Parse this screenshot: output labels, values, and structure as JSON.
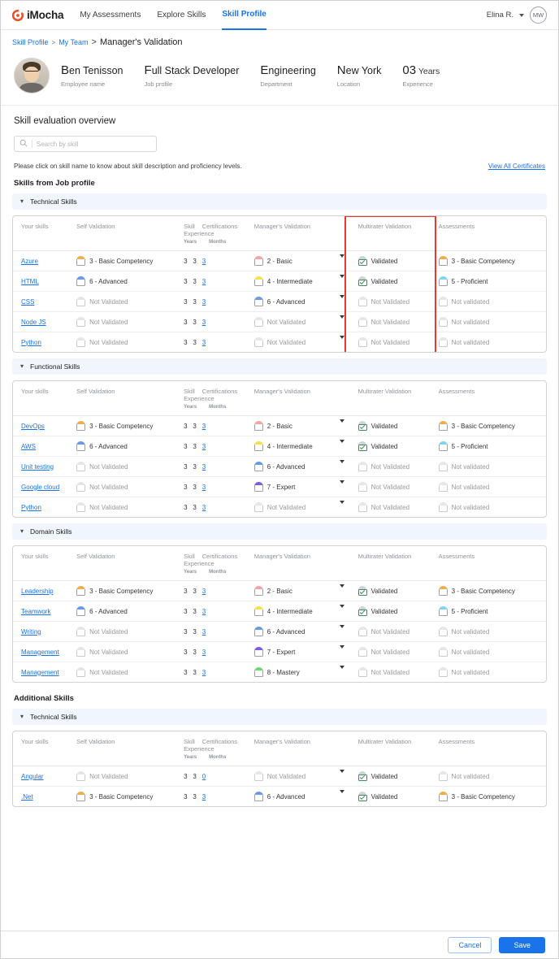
{
  "topnav": {
    "brand": "iMocha",
    "items": [
      {
        "label": "My Assessments",
        "active": false
      },
      {
        "label": "Explore Skills",
        "active": false
      },
      {
        "label": "Skill Profile",
        "active": true
      }
    ],
    "user_name": "Elina R.",
    "avatar_initials": "MW"
  },
  "breadcrumb": {
    "l1": "Skill Profile",
    "sep1": ">",
    "l2": "My Team",
    "sep2": ">",
    "current": "Manager's Validation"
  },
  "profile": {
    "fields": [
      {
        "value": "Ben Tenisson",
        "cap": "B",
        "rest": "en Tenisson",
        "label": "Employee name"
      },
      {
        "value": "Full Stack Developer",
        "cap": "F",
        "rest": "ull Stack Developer",
        "label": "Job profile"
      },
      {
        "value": "Engineering",
        "cap": "E",
        "rest": "ngineering",
        "label": "Department"
      },
      {
        "value": "New York",
        "cap": "N",
        "rest": "ew York",
        "label": "Location"
      },
      {
        "value": "03 Years",
        "cap": "03",
        "rest": " Years",
        "label": "Experience"
      }
    ]
  },
  "overview": {
    "title": "Skill evaluation overview",
    "search_placeholder": "Search by skill",
    "search_value": "",
    "hint": "Please click on skill name to know about skill description and proficiency levels.",
    "certificates_link": "View All Certificates",
    "group_job_profile": "Skills from Job profile",
    "group_additional": "Additional Skills"
  },
  "columns": {
    "skill": "Your skills",
    "self": "Self Validation",
    "experience": "Skill Experience",
    "years": "Years",
    "months": "Months",
    "certifications": "Certifications",
    "manager": "Manager's Validation",
    "multirater": "Multirater Validation",
    "assessments": "Assessments"
  },
  "sections": [
    {
      "accordion_label": "Technical Skills",
      "highlight_multirater": true,
      "rows": [
        {
          "skill": "Azure",
          "self": "3 - Basic Competency",
          "self_color": "#f0ad4e",
          "years": "3",
          "months": "3",
          "certs": "3",
          "mgr": "2 - Basic",
          "mgr_color": "#f5a3a3",
          "multi": "Validated",
          "multi_state": "validated",
          "assess": "3 - Basic Competency",
          "assess_color": "#f0ad4e"
        },
        {
          "skill": "HTML",
          "self": "6 - Advanced",
          "self_color": "#6b9ae8",
          "years": "3",
          "months": "3",
          "certs": "3",
          "mgr": "4 - Intermediate",
          "mgr_color": "#f5e04d",
          "multi": "Validated",
          "multi_state": "validated",
          "assess": "5 - Proficient",
          "assess_color": "#7fd4f0"
        },
        {
          "skill": "CSS",
          "self": "Not Validated",
          "self_color": "",
          "years": "3",
          "months": "3",
          "certs": "3",
          "mgr": "6 - Advanced",
          "mgr_color": "#6b9ae8",
          "multi": "Not Validated",
          "multi_state": "none",
          "assess": "Not  validated",
          "assess_color": ""
        },
        {
          "skill": "Node JS",
          "self": "Not Validated",
          "self_color": "",
          "years": "3",
          "months": "3",
          "certs": "3",
          "mgr": "Not Validated",
          "mgr_color": "",
          "multi": "Not Validated",
          "multi_state": "none",
          "assess": "Not  validated",
          "assess_color": ""
        },
        {
          "skill": "Python",
          "self": "Not Validated",
          "self_color": "",
          "years": "3",
          "months": "3",
          "certs": "3",
          "mgr": "Not Validated",
          "mgr_color": "",
          "multi": "Not Validated",
          "multi_state": "none",
          "assess": "Not  validated",
          "assess_color": ""
        }
      ]
    },
    {
      "accordion_label": "Functional Skills",
      "highlight_multirater": false,
      "rows": [
        {
          "skill": "DevOps",
          "self": "3 - Basic Competency",
          "self_color": "#f0ad4e",
          "years": "3",
          "months": "3",
          "certs": "3",
          "mgr": "2 - Basic",
          "mgr_color": "#f5a3a3",
          "multi": "Validated",
          "multi_state": "validated",
          "assess": "3 - Basic Competency",
          "assess_color": "#f0ad4e"
        },
        {
          "skill": "AWS",
          "self": "6 - Advanced",
          "self_color": "#6b9ae8",
          "years": "3",
          "months": "3",
          "certs": "3",
          "mgr": "4 - Intermediate",
          "mgr_color": "#f5e04d",
          "multi": "Validated",
          "multi_state": "validated",
          "assess": "5 - Proficient",
          "assess_color": "#7fd4f0"
        },
        {
          "skill": "Unit testing",
          "self": "Not Validated",
          "self_color": "",
          "years": "3",
          "months": "3",
          "certs": "3",
          "mgr": "6 - Advanced",
          "mgr_color": "#6b9ae8",
          "multi": "Not Validated",
          "multi_state": "none",
          "assess": "Not  validated",
          "assess_color": ""
        },
        {
          "skill": "Google cloud",
          "self": "Not Validated",
          "self_color": "",
          "years": "3",
          "months": "3",
          "certs": "3",
          "mgr": "7 - Expert",
          "mgr_color": "#7b5ce8",
          "multi": "Not Validated",
          "multi_state": "none",
          "assess": "Not  validated",
          "assess_color": ""
        },
        {
          "skill": "Python",
          "self": "Not Validated",
          "self_color": "",
          "years": "3",
          "months": "3",
          "certs": "3",
          "mgr": "Not Validated",
          "mgr_color": "",
          "multi": "Not Validated",
          "multi_state": "none",
          "assess": "Not  validated",
          "assess_color": ""
        }
      ]
    },
    {
      "accordion_label": "Domain Skills",
      "highlight_multirater": false,
      "rows": [
        {
          "skill": "Leadership",
          "self": "3 - Basic Competency",
          "self_color": "#f0ad4e",
          "years": "3",
          "months": "3",
          "certs": "3",
          "mgr": "2 - Basic",
          "mgr_color": "#f5a3a3",
          "multi": "Validated",
          "multi_state": "validated",
          "assess": "3 - Basic Competency",
          "assess_color": "#f0ad4e"
        },
        {
          "skill": "Teamwork",
          "self": "6 - Advanced",
          "self_color": "#6b9ae8",
          "years": "3",
          "months": "3",
          "certs": "3",
          "mgr": "4 - Intermediate",
          "mgr_color": "#f5e04d",
          "multi": "Validated",
          "multi_state": "validated",
          "assess": "5 - Proficient",
          "assess_color": "#7fd4f0"
        },
        {
          "skill": "Writing",
          "self": "Not Validated",
          "self_color": "",
          "years": "3",
          "months": "3",
          "certs": "3",
          "mgr": "6 - Advanced",
          "mgr_color": "#6b9ae8",
          "multi": "Not Validated",
          "multi_state": "none",
          "assess": "Not  validated",
          "assess_color": ""
        },
        {
          "skill": "Management",
          "self": "Not Validated",
          "self_color": "",
          "years": "3",
          "months": "3",
          "certs": "3",
          "mgr": "7 - Expert",
          "mgr_color": "#7b5ce8",
          "multi": "Not Validated",
          "multi_state": "none",
          "assess": "Not  validated",
          "assess_color": ""
        },
        {
          "skill": "Management",
          "self": "Not Validated",
          "self_color": "",
          "years": "3",
          "months": "3",
          "certs": "3",
          "mgr": "8 - Mastery",
          "mgr_color": "#6fd96f",
          "multi": "Not Validated",
          "multi_state": "none",
          "assess": "Not  validated",
          "assess_color": ""
        }
      ]
    },
    {
      "accordion_label": "Technical Skills",
      "highlight_multirater": false,
      "additional": true,
      "rows": [
        {
          "skill": "Angular",
          "self": "Not Validated",
          "self_color": "",
          "years": "3",
          "months": "3",
          "certs": "0",
          "mgr": "Not Validated",
          "mgr_color": "",
          "multi": "Validated",
          "multi_state": "validated",
          "assess": "Not  validated",
          "assess_color": ""
        },
        {
          "skill": ".Net",
          "self": "3 - Basic Competency",
          "self_color": "#f0ad4e",
          "years": "3",
          "months": "3",
          "certs": "3",
          "mgr": "6 - Advanced",
          "mgr_color": "#6b9ae8",
          "multi": "Validated",
          "multi_state": "validated",
          "assess": "3 - Basic Competency",
          "assess_color": "#f0ad4e"
        }
      ]
    }
  ],
  "footer": {
    "cancel": "Cancel",
    "save": "Save"
  },
  "colors": {
    "accent": "#1a73e8",
    "brand": "#e8522a",
    "highlight": "#e8392b"
  }
}
